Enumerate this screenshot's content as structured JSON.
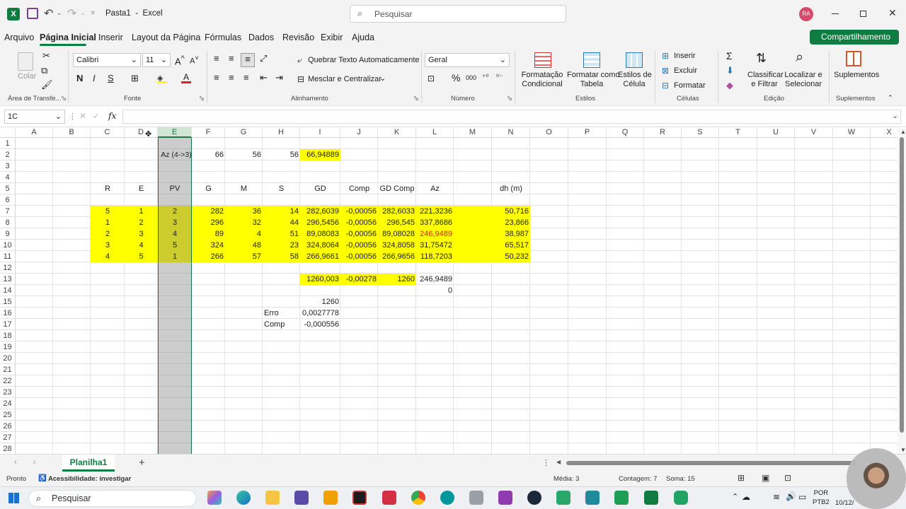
{
  "app": {
    "file_title": "Pasta1",
    "separator": "-",
    "app_name": "Excel",
    "avatar_initials": "RA",
    "search_placeholder": "Pesquisar"
  },
  "menu": {
    "items": [
      "Arquivo",
      "Página Inicial",
      "Inserir",
      "Layout da Página",
      "Fórmulas",
      "Dados",
      "Revisão",
      "Exibir",
      "Ajuda"
    ],
    "active": "Página Inicial",
    "share_label": "Compartilhamento"
  },
  "ribbon": {
    "clipboard": {
      "paste_label": "Colar",
      "group_label": "Área de Transfe..."
    },
    "font": {
      "font_name": "Calibri",
      "font_size": "11",
      "bold": "N",
      "italic": "I",
      "underline": "S",
      "grow": "A^",
      "shrink": "A˅",
      "group_label": "Fonte"
    },
    "alignment": {
      "wrap_label": "Quebrar Texto Automaticamente",
      "merge_label": "Mesclar e Centralizar",
      "group_label": "Alinhamento"
    },
    "number": {
      "format": "Geral",
      "group_label": "Número"
    },
    "styles": {
      "conditional_line1": "Formatação",
      "conditional_line2": "Condicional",
      "table_line1": "Formatar como",
      "table_line2": "Tabela",
      "cell_line1": "Estilos de",
      "cell_line2": "Célula",
      "group_label": "Estilos"
    },
    "cells": {
      "insert": "Inserir",
      "delete": "Excluir",
      "format": "Formatar",
      "group_label": "Células"
    },
    "editing": {
      "sort_line1": "Classificar",
      "sort_line2": "e Filtrar",
      "find_line1": "Localizar e",
      "find_line2": "Selecionar",
      "group_label": "Edição"
    },
    "addins": {
      "label": "Suplementos",
      "group_label": "Suplementos"
    }
  },
  "formula_bar": {
    "name_box": "1C",
    "fx": "fx",
    "content": ""
  },
  "sheet": {
    "columns": [
      "A",
      "B",
      "C",
      "D",
      "E",
      "F",
      "G",
      "H",
      "I",
      "J",
      "K",
      "L",
      "M",
      "N",
      "O",
      "P",
      "Q",
      "R",
      "S",
      "T",
      "U",
      "V",
      "W",
      "X"
    ],
    "rows": [
      "1",
      "2",
      "3",
      "4",
      "5",
      "6",
      "7",
      "8",
      "9",
      "10",
      "11",
      "12",
      "13",
      "14",
      "15",
      "16",
      "17",
      "18",
      "19",
      "20",
      "21",
      "22",
      "23",
      "24",
      "25",
      "26",
      "27",
      "28"
    ],
    "selected_column": "E",
    "cells": {
      "E2": "Az (4->3)",
      "F2": "66",
      "G2": "56",
      "H2": "56",
      "I2": "66,94889",
      "C5": "R",
      "D5": "E",
      "E5": "PV",
      "F5": "G",
      "G5": "M",
      "H5": "S",
      "I5": "GD",
      "J5": "Comp",
      "K5": "GD Comp",
      "L5": "Az",
      "N5": "dh (m)",
      "C7": "5",
      "D7": "1",
      "E7": "2",
      "F7": "282",
      "G7": "36",
      "H7": "14",
      "I7": "282,6039",
      "J7": "-0,00056",
      "K7": "282,6033",
      "L7": "221,3236",
      "N7": "50,716",
      "C8": "1",
      "D8": "2",
      "E8": "3",
      "F8": "296",
      "G8": "32",
      "H8": "44",
      "I8": "296,5456",
      "J8": "-0,00056",
      "K8": "296,545",
      "L8": "337,8686",
      "N8": "23,866",
      "C9": "2",
      "D9": "3",
      "E9": "4",
      "F9": "89",
      "G9": "4",
      "H9": "51",
      "I9": "89,08083",
      "J9": "-0,00056",
      "K9": "89,08028",
      "L9": "246,9489",
      "N9": "38,987",
      "C10": "3",
      "D10": "4",
      "E10": "5",
      "F10": "324",
      "G10": "48",
      "H10": "23",
      "I10": "324,8064",
      "J10": "-0,00056",
      "K10": "324,8058",
      "L10": "31,75472",
      "N10": "65,517",
      "C11": "4",
      "D11": "5",
      "E11": "1",
      "F11": "266",
      "G11": "57",
      "H11": "58",
      "I11": "266,9661",
      "J11": "-0,00056",
      "K11": "266,9656",
      "L11": "118,7203",
      "N11": "50,232",
      "I13": "1260,003",
      "J13": "-0,00278",
      "K13": "1260",
      "L13": "246,9489",
      "L14": "0",
      "I15": "1260",
      "H16": "Erro",
      "I16": "0,0027778",
      "H17": "Comp",
      "I17": "-0,000556"
    }
  },
  "tabs": {
    "sheet_name": "Planilha1",
    "add": "+"
  },
  "status": {
    "ready": "Pronto",
    "accessibility": "Acessibilidade: investigar",
    "average": "Média: 3",
    "count": "Contagem: 7",
    "sum": "Soma: 15"
  },
  "taskbar": {
    "search": "Pesquisar",
    "lang1": "POR",
    "lang2": "PTB2",
    "date": "10/12/"
  },
  "colors": {
    "yellow": "#ffff00",
    "selected_col": "#c8c8c8",
    "excel_green": "#107c41",
    "red_text": "#e0201c"
  }
}
